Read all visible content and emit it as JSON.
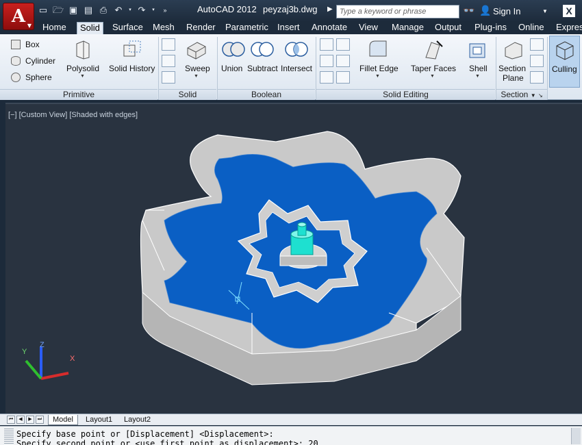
{
  "titlebar": {
    "app_name": "AutoCAD 2012",
    "file_name": "peyzaj3b.dwg",
    "search_placeholder": "Type a keyword or phrase",
    "sign_in": "Sign In",
    "app_letter": "A"
  },
  "tabs": [
    "Home",
    "Solid",
    "Surface",
    "Mesh",
    "Render",
    "Parametric",
    "Insert",
    "Annotate",
    "View",
    "Manage",
    "Output",
    "Plug-ins",
    "Online",
    "Express"
  ],
  "active_tab": "Solid",
  "ribbon": {
    "primitive": {
      "title": "Primitive",
      "box": "Box",
      "cylinder": "Cylinder",
      "sphere": "Sphere",
      "polysolid": "Polysolid",
      "solid_history": "Solid History"
    },
    "solid": {
      "title": "Solid",
      "sweep": "Sweep"
    },
    "boolean": {
      "title": "Boolean",
      "union": "Union",
      "subtract": "Subtract",
      "intersect": "Intersect"
    },
    "solid_editing": {
      "title": "Solid Editing",
      "fillet_edge": "Fillet Edge",
      "taper_faces": "Taper Faces",
      "shell": "Shell"
    },
    "section": {
      "title": "Section",
      "section_plane_1": "Section",
      "section_plane_2": "Plane",
      "culling": "Culling"
    }
  },
  "viewport": {
    "label": "[−] [Custom View] [Shaded with edges]",
    "ucs": {
      "x": "X",
      "y": "Y",
      "z": "Z"
    }
  },
  "layout_tabs": [
    "Model",
    "Layout1",
    "Layout2"
  ],
  "active_layout": "Model",
  "command_line": [
    "Specify base point or [Displacement] <Displacement>:",
    "Specify second point or <use first point as displacement>: 20"
  ],
  "colors": {
    "water": "#0a5fc4",
    "wall": "#c9c9c9",
    "fountain": "#1ee0d0",
    "background": "#293340"
  }
}
